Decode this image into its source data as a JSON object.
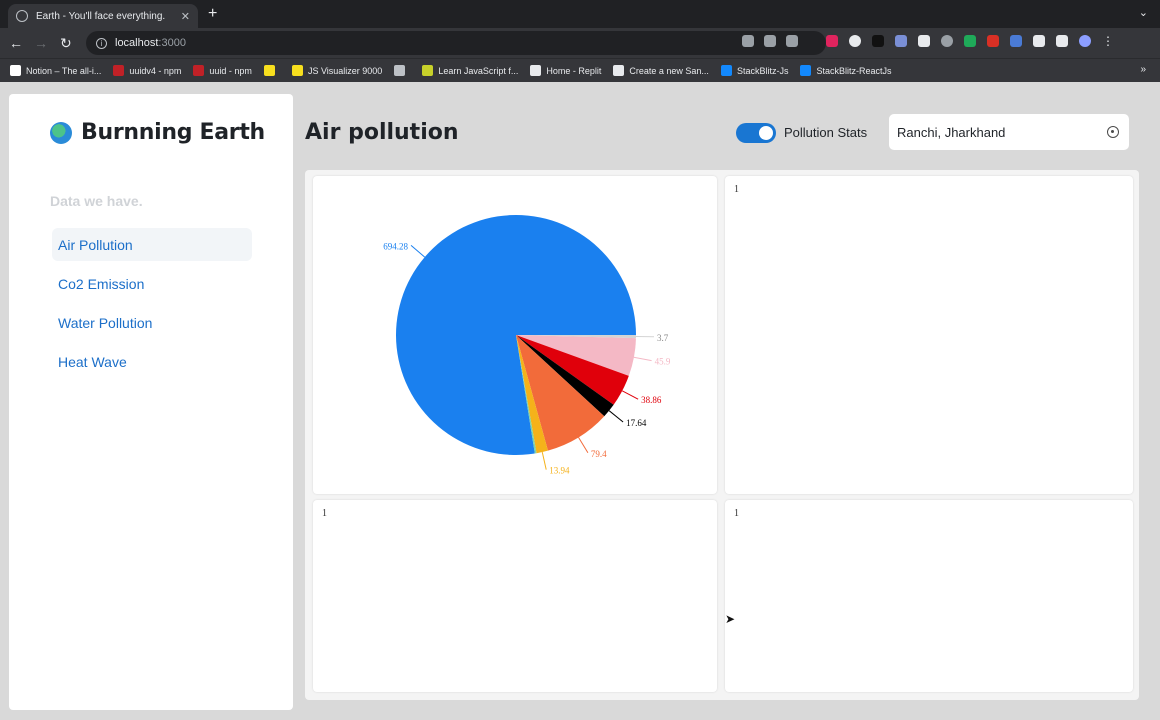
{
  "browser": {
    "tab_title": "Earth - You'll face everything.",
    "url_host": "localhost",
    "url_port": ":3000",
    "bookmarks": [
      {
        "label": "Notion – The all-i...",
        "color": "#ffffff"
      },
      {
        "label": "uuidv4 - npm",
        "color": "#c12127"
      },
      {
        "label": "uuid - npm",
        "color": "#c12127"
      },
      {
        "label": "",
        "color": "#f7df1e"
      },
      {
        "label": "JS Visualizer 9000",
        "color": "#f7df1e"
      },
      {
        "label": "",
        "color": "#bdc1c6"
      },
      {
        "label": "Learn JavaScript f...",
        "color": "#c7d12a"
      },
      {
        "label": "Home - Replit",
        "color": "#e8eaed"
      },
      {
        "label": "Create a new San...",
        "color": "#e8eaed"
      },
      {
        "label": "StackBlitz-Js",
        "color": "#1389fd"
      },
      {
        "label": "StackBlitz-ReactJs",
        "color": "#1389fd"
      }
    ]
  },
  "sidebar": {
    "brand": "Burnning Earth",
    "heading": "Data we have.",
    "items": [
      {
        "label": "Air Pollution",
        "active": true
      },
      {
        "label": "Co2 Emission",
        "active": false
      },
      {
        "label": "Water Pollution",
        "active": false
      },
      {
        "label": "Heat Wave",
        "active": false
      }
    ]
  },
  "header": {
    "title": "Air pollution",
    "toggle_label": "Pollution Stats",
    "toggle_on": true,
    "location_value": "Ranchi, Jharkhand"
  },
  "cards": {
    "placeholder_top_right": "1",
    "placeholder_bottom_left": "1",
    "placeholder_bottom_right": "1"
  },
  "colors": {
    "accent": "#1976d2",
    "nav_link": "#1c6fc9"
  },
  "chart_data": {
    "type": "pie",
    "slices": [
      {
        "label": "694.28",
        "value": 694.28,
        "color": "#1a80ef"
      },
      {
        "label": "3.7",
        "value": 3.7,
        "color": "#d4d4d4"
      },
      {
        "label": "45.9",
        "value": 45.9,
        "color": "#f4b8c5"
      },
      {
        "label": "38.86",
        "value": 38.86,
        "color": "#e0000b"
      },
      {
        "label": "17.64",
        "value": 17.64,
        "color": "#000000"
      },
      {
        "label": "79.4",
        "value": 79.4,
        "color": "#f26b3a"
      },
      {
        "label": "13.94",
        "value": 13.94,
        "color": "#f5b21a"
      },
      {
        "label": "",
        "value": 2.0,
        "color": "#7fd3a8"
      }
    ]
  }
}
